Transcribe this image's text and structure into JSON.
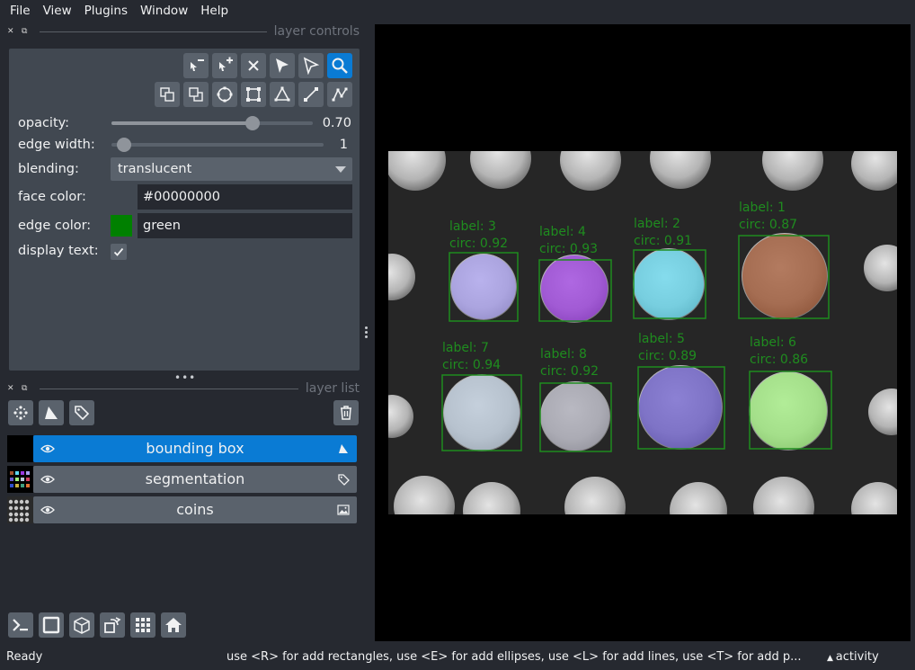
{
  "menu": [
    "File",
    "View",
    "Plugins",
    "Window",
    "Help"
  ],
  "layer_controls": {
    "title": "layer controls",
    "opacity_label": "opacity:",
    "opacity_value": "0.70",
    "opacity": 0.7,
    "edge_width_label": "edge width:",
    "edge_width_value": "1",
    "blending_label": "blending:",
    "blending_value": "translucent",
    "face_color_label": "face color:",
    "face_color_value": "#00000000",
    "edge_color_label": "edge color:",
    "edge_color_value": "green",
    "edge_color_swatch": "#008000",
    "display_text_label": "display text:",
    "display_text_checked": true,
    "active_tool": "zoom-icon"
  },
  "layer_list": {
    "title": "layer list",
    "layers": [
      {
        "name": "bounding box",
        "type": "shapes",
        "visible": true,
        "selected": true
      },
      {
        "name": "segmentation",
        "type": "labels",
        "visible": true,
        "selected": false
      },
      {
        "name": "coins",
        "type": "image",
        "visible": true,
        "selected": false
      }
    ]
  },
  "canvas": {
    "annotations": [
      {
        "label": "label: 1",
        "circ": "circ: 0.87",
        "color": "#a0522d"
      },
      {
        "label": "label: 2",
        "circ": "circ: 0.91",
        "color": "#5fd8f0"
      },
      {
        "label": "label: 3",
        "circ": "circ: 0.92",
        "color": "#a89ef0"
      },
      {
        "label": "label: 4",
        "circ": "circ: 0.93",
        "color": "#9a38e0"
      },
      {
        "label": "label: 5",
        "circ": "circ: 0.89",
        "color": "#6a5acd"
      },
      {
        "label": "label: 6",
        "circ": "circ: 0.86",
        "color": "#9ef07a"
      },
      {
        "label": "label: 7",
        "circ": "circ: 0.94",
        "color": "#b8c8d8"
      },
      {
        "label": "label: 8",
        "circ": "circ: 0.92",
        "color": "#a8a8b4"
      }
    ],
    "annotation_color": "#1f8c1f"
  },
  "status": {
    "ready": "Ready",
    "hint": "use <R> for add rectangles, use <E> for add ellipses, use <L> for add lines, use <T> for add p...",
    "activity": "activity"
  }
}
